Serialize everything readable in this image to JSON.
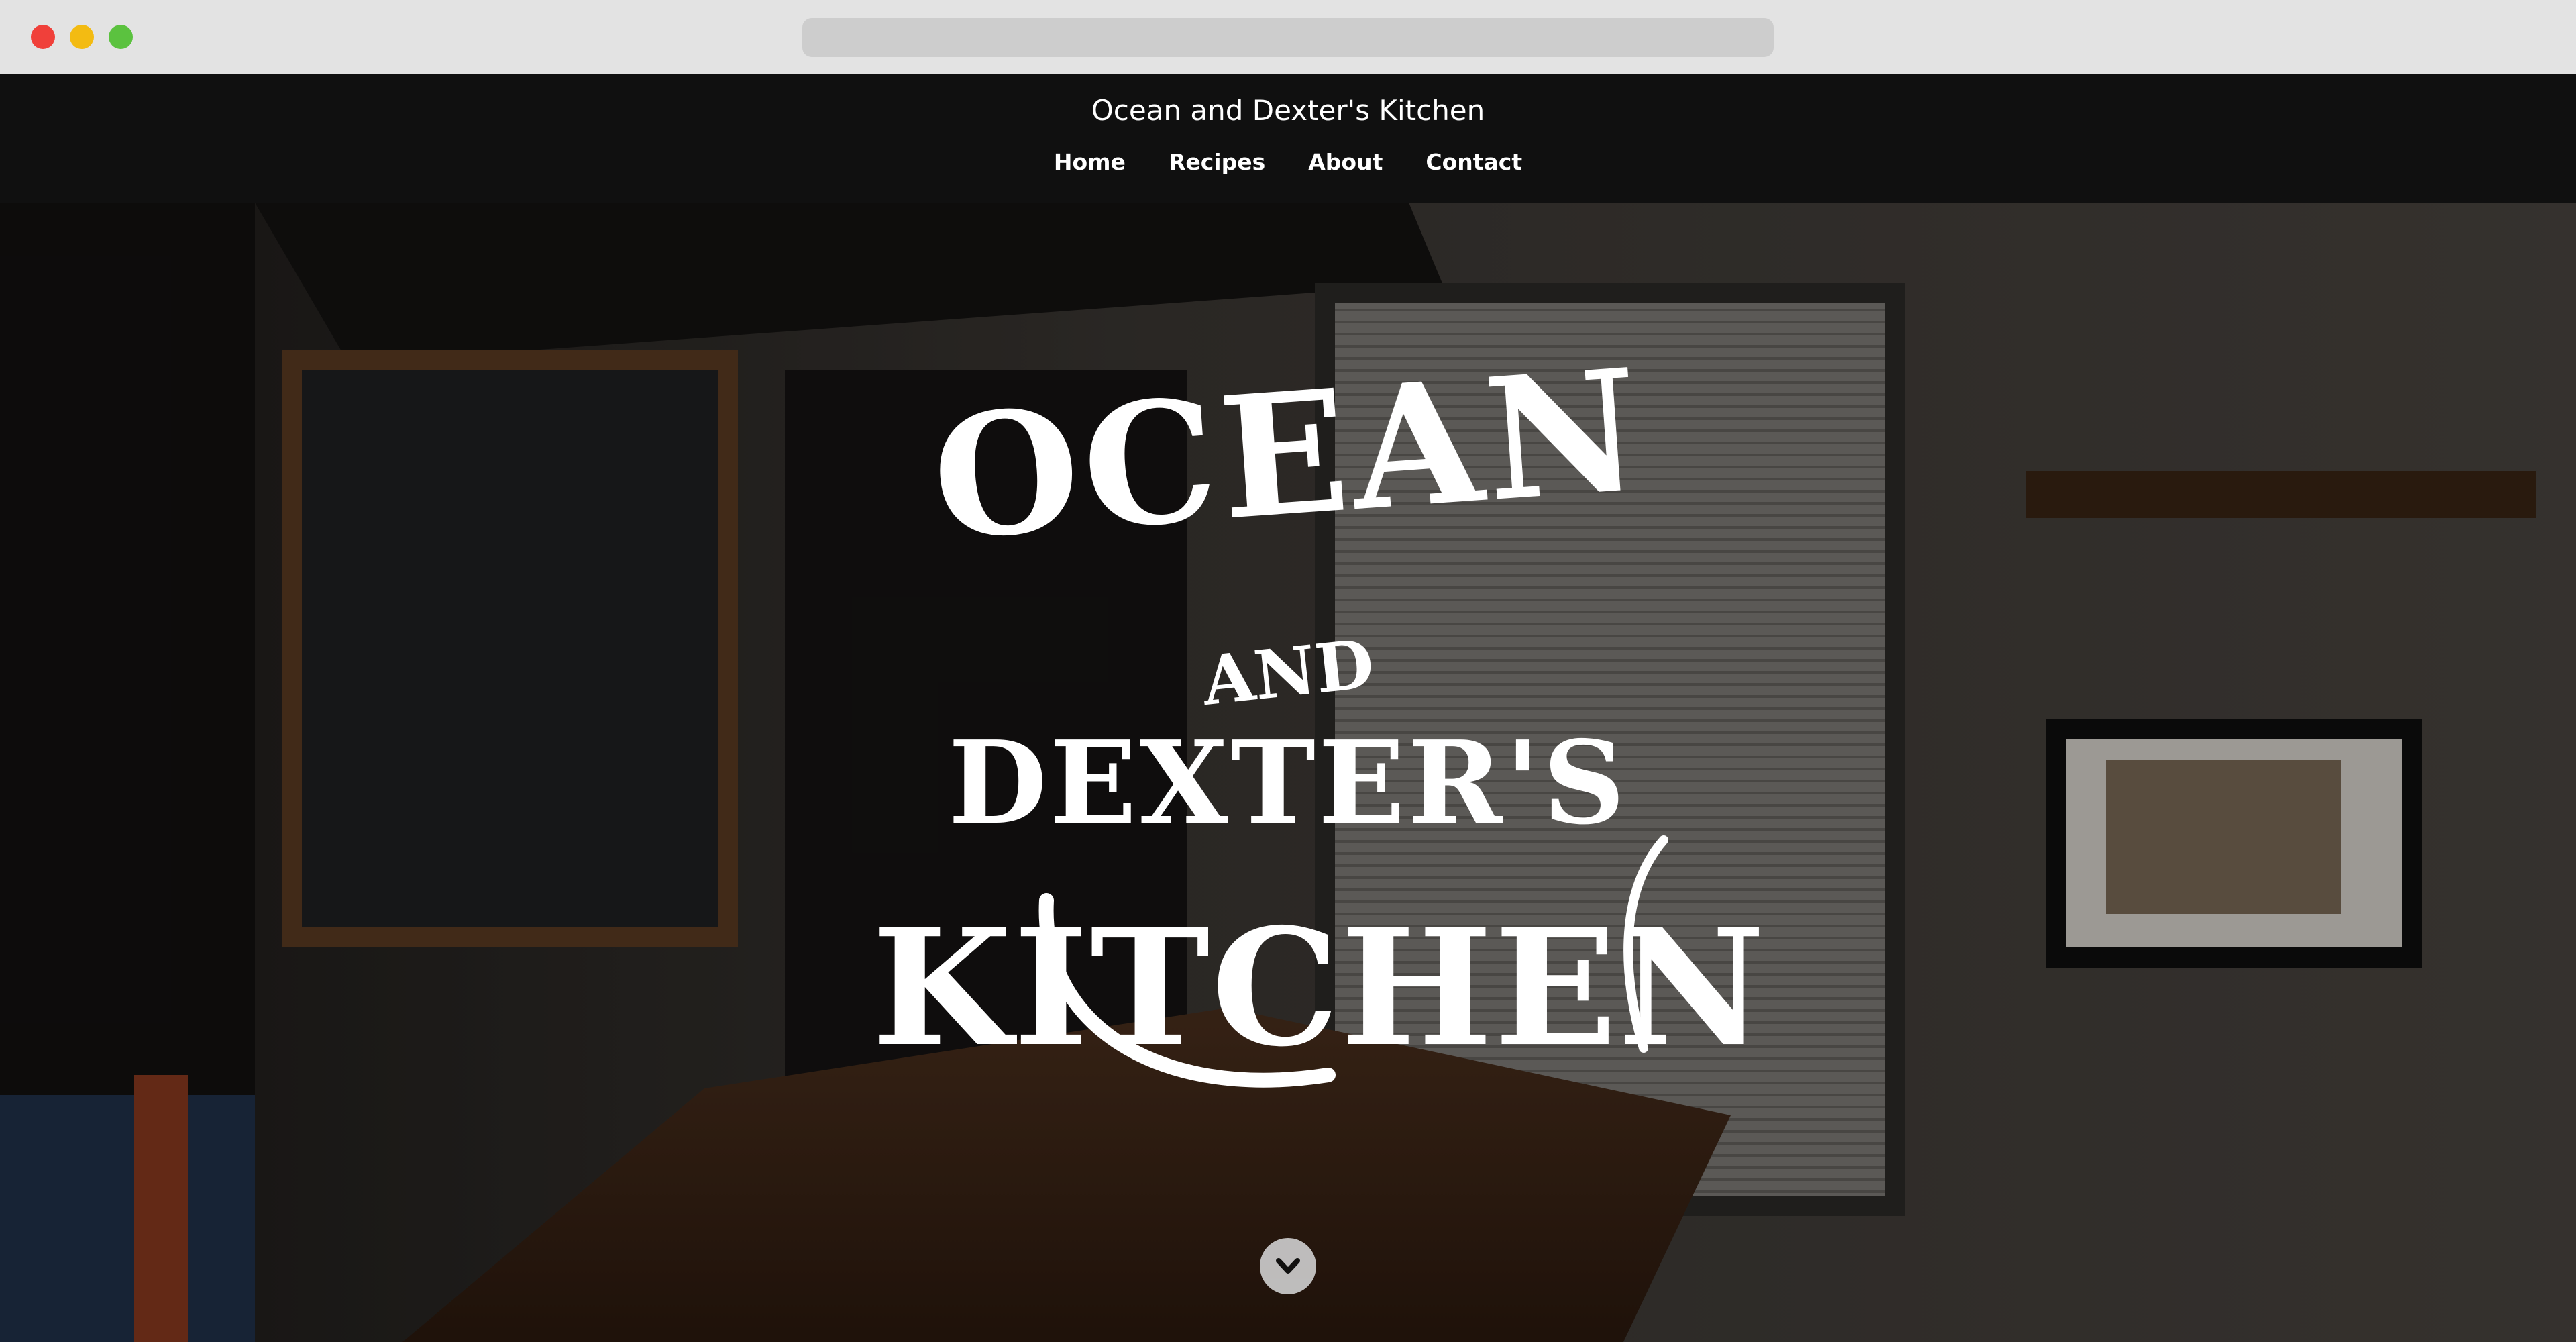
{
  "browser": {
    "window_controls": [
      "close",
      "minimize",
      "maximize"
    ],
    "url": ""
  },
  "site": {
    "title": "Ocean and Dexter's Kitchen",
    "nav": [
      {
        "label": "Home"
      },
      {
        "label": "Recipes"
      },
      {
        "label": "About"
      },
      {
        "label": "Contact"
      }
    ]
  },
  "hero": {
    "logo": {
      "line1": "OCEAN",
      "line2": "AND",
      "line3": "DEXTER'S",
      "line4": "KITCHEN"
    },
    "scroll_icon": "chevron-down-icon"
  },
  "colors": {
    "header_bg": "#101010",
    "chrome_bg": "#e3e3e3",
    "text": "#ffffff"
  }
}
